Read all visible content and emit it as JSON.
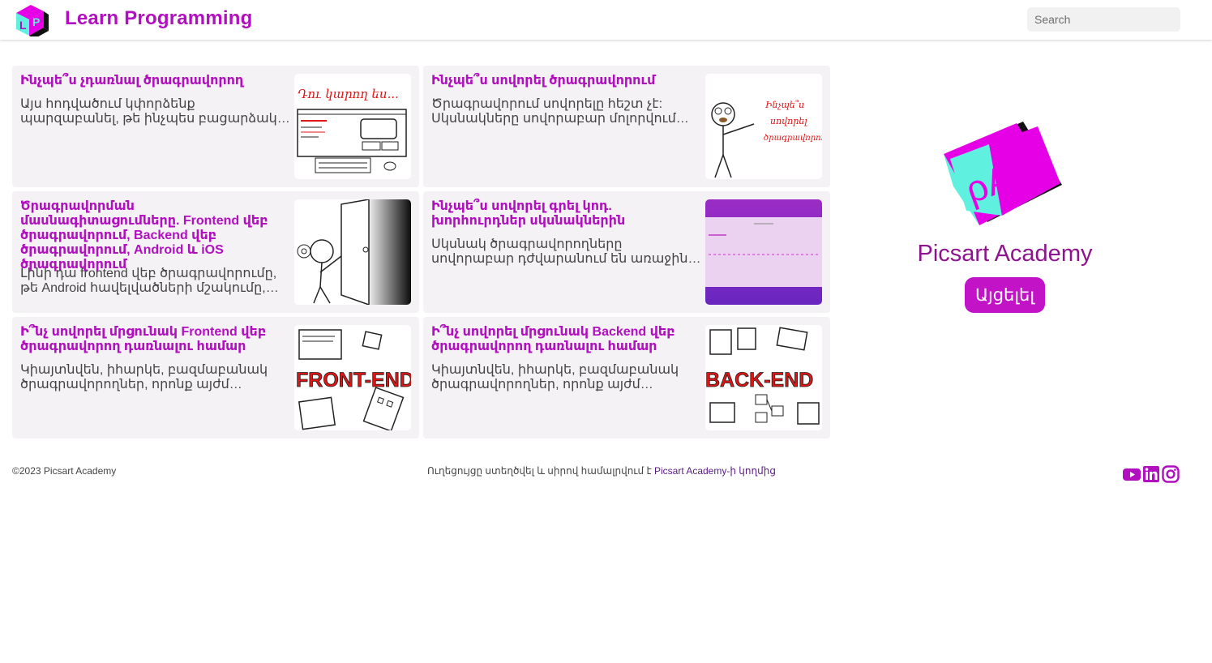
{
  "header": {
    "site_title": "Learn Programming",
    "logo_text": "LP",
    "search_placeholder": "Search"
  },
  "cards": [
    {
      "title": "Ինչպե՞ս չդառնալ ծրագրավորող",
      "description": "Այս հոդվածում կփորձենք պարզաբանել, թե ինչպես բացարձակ սկսնակին դառնալ լավ ծրագրավորող",
      "image_caption": "Դու կարող ես..."
    },
    {
      "title": "Ինչպե՞ս սովորել ծրագրավորում",
      "description": "Ծրագրավորում սովորելը հեշտ չէ: Սկսնակները սովորաբար մոլորվում են…",
      "image_caption": "Ինչպե՞ս սովորել ծրագրավորում"
    },
    {
      "title": "Ծրագրավորման մասնագիտացումները. Frontend վեբ ծրագրավորում, Backend վեբ ծրագրավորում, Android և iOS ծրագրավորում",
      "description": "Լինի դա frontend վեբ ծրագրավորումը, թե Android հավելվածների մշակումը, ամեն մասնագիտացում",
      "image_caption": ""
    },
    {
      "title": "Ինչպե՞ս սովորել գրել կոդ. խորհուրդներ սկսնակներին",
      "description": "Սկսնակ ծրագրավորողները սովորաբար դժվարանում են առաջին անգամ կոդ գրելու ժամանակ",
      "image_caption": ""
    },
    {
      "title": "Ի՞նչ սովորել մրցունակ Frontend վեբ ծրագրավորող դառնալու համար",
      "description": "Կիայտնվեն, իհարկե, բազմաբանակ ծրագրավորողներ, որոնք այժմ աշխատում են",
      "image_caption": "FRONT-END"
    },
    {
      "title": "Ի՞նչ սովորել մրցունակ Backend վեբ ծրագրավորող դառնալու համար",
      "description": "Կիայտնվեն, իհարկե, բազմաբանակ ծրագրավորողներ, որոնք այժմ աշխատում են",
      "image_caption": "BACK-END"
    }
  ],
  "promo": {
    "logo_text": "ρA",
    "name": "Picsart Academy",
    "button_label": "Այցելել"
  },
  "footer": {
    "copyright": "©2023 Picsart Academy",
    "credit_text": "Ուղեցույցը ստեղծվել և սիրով համալրվում է ",
    "credit_link": "Picsart Academy-ի կողմից",
    "social": [
      "youtube-icon",
      "linkedin-icon",
      "instagram-icon"
    ]
  },
  "colors": {
    "brand": "#b10fbf",
    "card_bg": "#f4f2f4",
    "button": "#c213c7",
    "cube_teal": "#5ff0e0",
    "cube_magenta": "#e600e6"
  }
}
